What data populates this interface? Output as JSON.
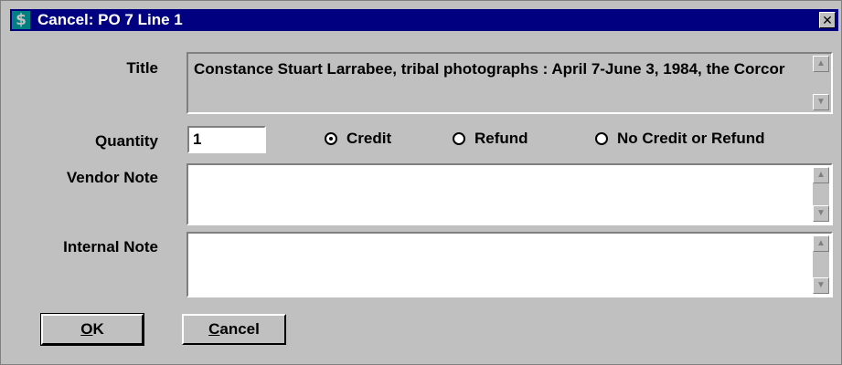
{
  "window": {
    "title": "Cancel: PO 7 Line 1",
    "app_icon_glyph": "$",
    "close_glyph": "✕"
  },
  "fields": {
    "title_label": "Title",
    "title_value": "Constance Stuart Larrabee, tribal photographs : April 7-June 3, 1984, the Corcor",
    "quantity_label": "Quantity",
    "quantity_value": "1",
    "vendor_note_label": "Vendor Note",
    "vendor_note_value": "",
    "internal_note_label": "Internal Note",
    "internal_note_value": ""
  },
  "radios": {
    "credit_label": "Credit",
    "refund_label": "Refund",
    "no_credit_label": "No Credit or Refund",
    "selected": "credit"
  },
  "buttons": {
    "ok_label": "OK",
    "cancel_label": "Cancel"
  },
  "icons": {
    "scroll_up": "▲",
    "scroll_down": "▼"
  },
  "colors": {
    "titlebar": "#000080",
    "face": "#c0c0c0"
  }
}
